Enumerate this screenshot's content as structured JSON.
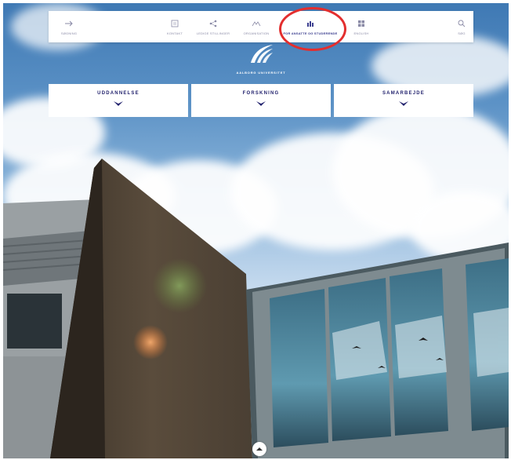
{
  "nav": {
    "items": [
      {
        "label": "Søgning",
        "icon": "arrow-right-icon"
      },
      {
        "label": "Kontakt",
        "icon": "contact-icon"
      },
      {
        "label": "Ledige stillinger",
        "icon": "share-icon"
      },
      {
        "label": "Organisation",
        "icon": "organisation-icon"
      },
      {
        "label": "For ansatte og studerende",
        "icon": "people-icon",
        "active": true
      },
      {
        "label": "English",
        "icon": "grid-icon"
      },
      {
        "label": "Søg",
        "icon": "search-icon"
      }
    ]
  },
  "brand": {
    "name": "AALBORG UNIVERSITET"
  },
  "menu": {
    "boxes": [
      {
        "label": "UDDANNELSE"
      },
      {
        "label": "FORSKNING"
      },
      {
        "label": "SAMARBEJDE"
      }
    ]
  },
  "colors": {
    "accent": "#23236e",
    "highlight": "#e32e2e",
    "nav_text": "#8a8aa6"
  }
}
